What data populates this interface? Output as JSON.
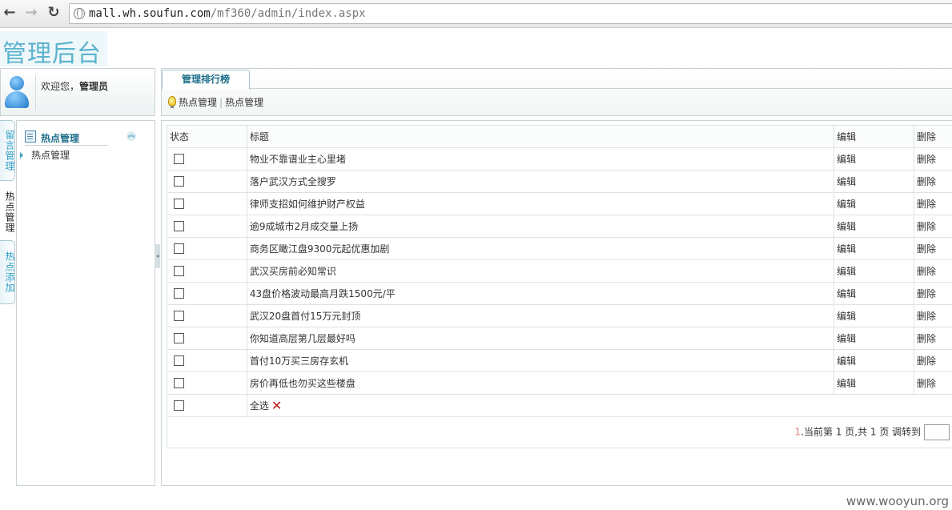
{
  "browser": {
    "url_host": "mall.wh.soufun.com",
    "url_path": "/mf360/admin/index.aspx"
  },
  "header": {
    "logo_text": "管理后台"
  },
  "user": {
    "welcome": "欢迎您，",
    "name": "管理员"
  },
  "tabs": {
    "active": "管理排行榜"
  },
  "breadcrumb": [
    "热点管理",
    "热点管理"
  ],
  "side_tabs": [
    "留言管理",
    "热点管理",
    "热点添加"
  ],
  "sidebar": {
    "title": "热点管理",
    "items": [
      "热点管理"
    ]
  },
  "table": {
    "headers": {
      "status": "状态",
      "title": "标题",
      "edit": "编辑",
      "delete": "删除"
    },
    "rows": [
      {
        "title": "物业不靠谱业主心里堵",
        "edit": "编辑",
        "delete": "删除"
      },
      {
        "title": "落户武汉方式全搜罗",
        "edit": "编辑",
        "delete": "删除"
      },
      {
        "title": "律师支招如何维护财产权益",
        "edit": "编辑",
        "delete": "删除"
      },
      {
        "title": "逾9成城市2月成交量上扬",
        "edit": "编辑",
        "delete": "删除"
      },
      {
        "title": "商务区瞰江盘9300元起优惠加剧",
        "edit": "编辑",
        "delete": "删除"
      },
      {
        "title": "武汉买房前必知常识",
        "edit": "编辑",
        "delete": "删除"
      },
      {
        "title": "43盘价格波动最高月跌1500元/平",
        "edit": "编辑",
        "delete": "删除"
      },
      {
        "title": "武汉20盘首付15万元封顶",
        "edit": "编辑",
        "delete": "删除"
      },
      {
        "title": "你知道高层第几层最好吗",
        "edit": "编辑",
        "delete": "删除"
      },
      {
        "title": "首付10万买三房存玄机",
        "edit": "编辑",
        "delete": "删除"
      },
      {
        "title": "房价再低也勿买这些楼盘",
        "edit": "编辑",
        "delete": "删除"
      }
    ],
    "select_all": "全选"
  },
  "pager": {
    "page_link": "1",
    "text": ".当前第 1 页,共 1 页 调转到"
  },
  "watermark": "www.wooyun.org",
  "colors": {
    "accent": "#1d6f8a",
    "logo": "#5bb3cf",
    "delete_x": "#c01818"
  }
}
